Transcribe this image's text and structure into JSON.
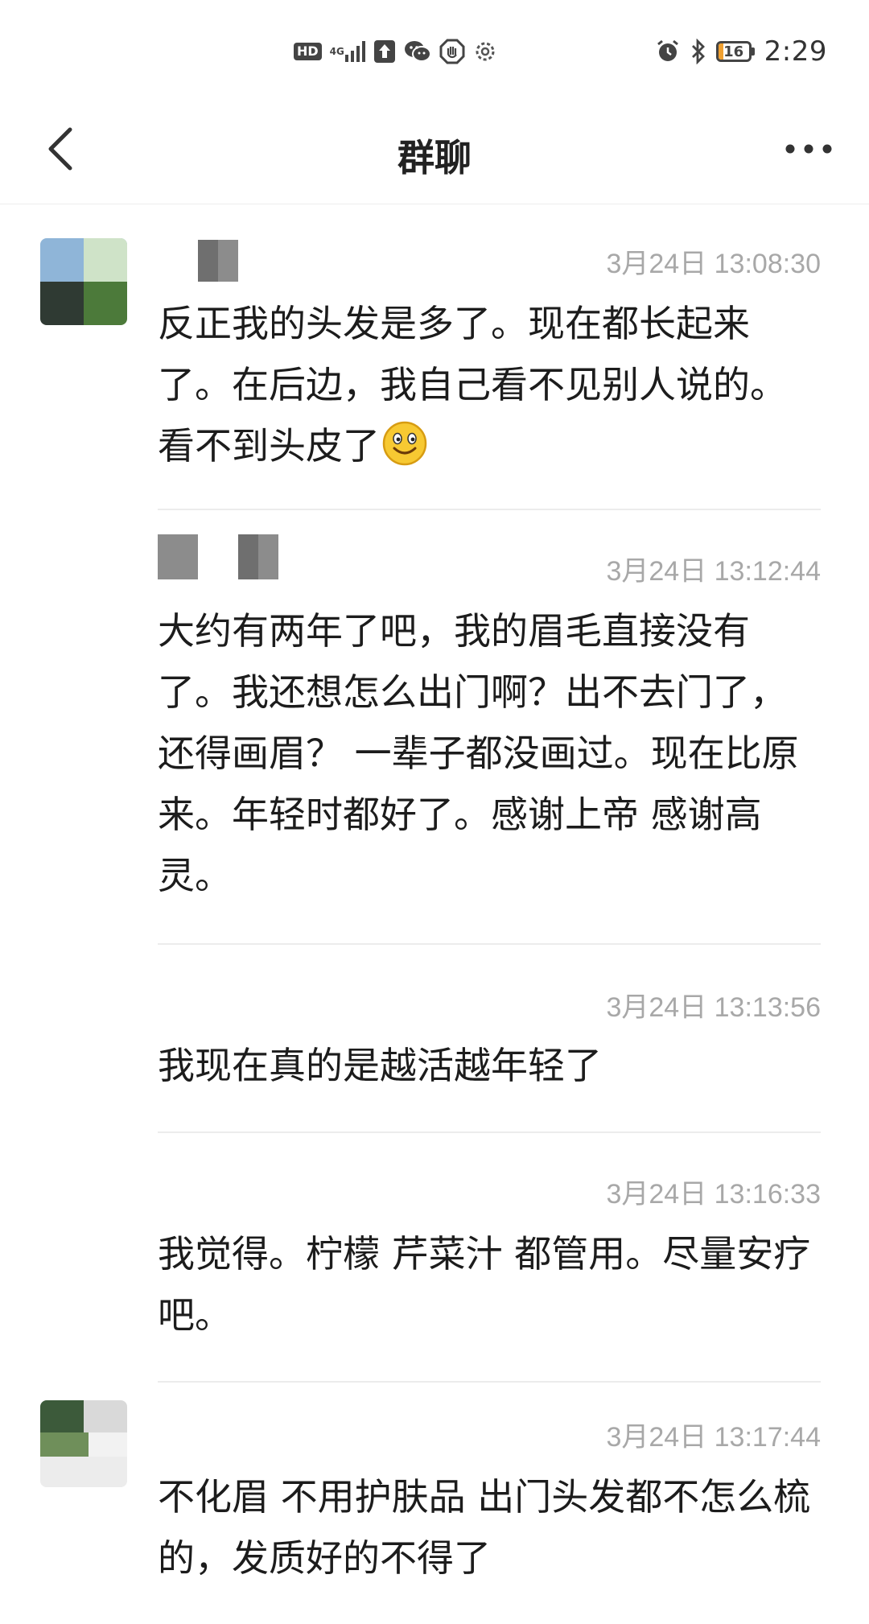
{
  "status_bar": {
    "hd_label": "HD",
    "network_label": "4G",
    "battery_level": "16",
    "time": "2:29"
  },
  "header": {
    "title": "群聊"
  },
  "messages": [
    {
      "timestamp": "3月24日 13:08:30",
      "text": "反正我的头发是多了。现在都长起来了。在后边，我自己看不见别人说的。看不到头皮了",
      "trailing_emoji": "smile-emoji"
    },
    {
      "timestamp": "3月24日 13:12:44",
      "text": "大约有两年了吧，我的眉毛直接没有了。我还想怎么出门啊？出不去门了，还得画眉？ 一辈子都没画过。现在比原来。年轻时都好了。感谢上帝 感谢高灵。"
    },
    {
      "timestamp": "3月24日 13:13:56",
      "text": "我现在真的是越活越年轻了"
    },
    {
      "timestamp": "3月24日 13:16:33",
      "text": "我觉得。柠檬 芹菜汁 都管用。尽量安疗吧。"
    },
    {
      "timestamp": "3月24日 13:17:44",
      "text": "不化眉  不用护肤品  出门头发都不怎么梳的，发质好的不得了"
    }
  ],
  "colors": {
    "timestamp": "#a8a8a8",
    "text": "#1c1c1c",
    "divider": "#ececec",
    "battery_fill": "#f0a030"
  }
}
